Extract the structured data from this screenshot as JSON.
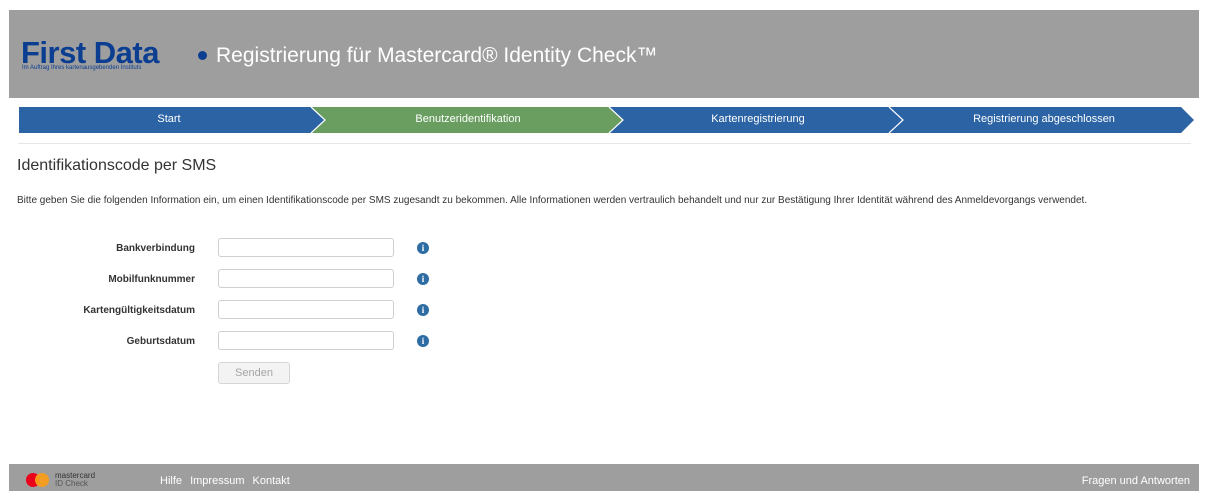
{
  "header": {
    "logo_text": "First Data",
    "logo_subtitle": "Im Auftrag Ihres kartenausgebenden Instituts",
    "title": "Registrierung für Mastercard® Identity Check™"
  },
  "steps": [
    {
      "label": "Start",
      "state": "done"
    },
    {
      "label": "Benutzeridentifikation",
      "state": "active"
    },
    {
      "label": "Kartenregistrierung",
      "state": "pending"
    },
    {
      "label": "Registrierung abgeschlossen",
      "state": "pending"
    }
  ],
  "colors": {
    "step_default": "#2b63a5",
    "step_active": "#6a9e61",
    "header_bg": "#9e9e9e",
    "info_icon": "#2e6da4"
  },
  "main": {
    "title": "Identifikationscode per SMS",
    "intro": "Bitte geben Sie die folgenden Information ein, um einen Identifikationscode per SMS zugesandt zu bekommen. Alle Informationen werden vertraulich behandelt und nur zur Bestätigung Ihrer Identität während des Anmeldevorgangs verwendet."
  },
  "form": {
    "fields": [
      {
        "label": "Bankverbindung",
        "value": "",
        "icon": "info-icon"
      },
      {
        "label": "Mobilfunknummer",
        "value": "",
        "icon": "info-icon"
      },
      {
        "label": "Kartengültigkeitsdatum",
        "value": "",
        "icon": "info-icon"
      },
      {
        "label": "Geburtsdatum",
        "value": "",
        "icon": "info-icon"
      }
    ],
    "submit_label": "Senden"
  },
  "footer": {
    "brand_line1": "mastercard",
    "brand_line2": "ID Check",
    "links": [
      "Hilfe",
      "Impressum",
      "Kontakt"
    ],
    "faq_label": "Fragen und Antworten"
  }
}
